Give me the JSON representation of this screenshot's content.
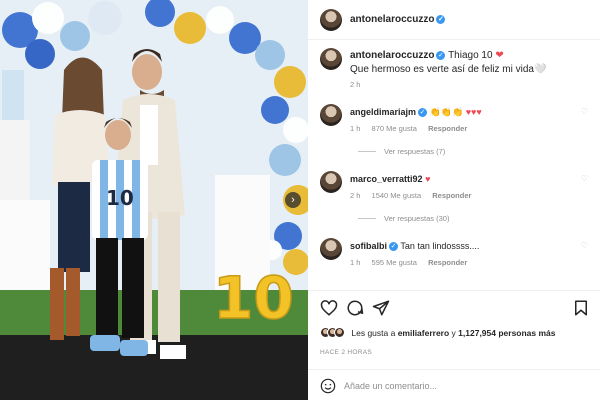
{
  "post": {
    "author": "antonelaroccuzzo",
    "caption_title": "Thiago 10",
    "caption_heart": "❤",
    "caption_body": "Que hermoso es verte así de feliz mi vida🤍",
    "caption_time": "2 h",
    "photo_big_number": "10",
    "photo_jersey_number": "10"
  },
  "comments": [
    {
      "username": "angeldimariajm",
      "text": "",
      "emojis_yellow": "👏👏👏",
      "emojis_red": "♥♥♥",
      "age": "1 h",
      "likes": "870 Me gusta",
      "reply": "Responder",
      "view_replies": "Ver respuestas (7)"
    },
    {
      "username": "marco_verratti92",
      "emojis_red": "♥",
      "age": "2 h",
      "likes": "1540 Me gusta",
      "reply": "Responder",
      "view_replies": "Ver respuestas (30)"
    },
    {
      "username": "sofibalbi",
      "text": "Tan tan lindossss....",
      "age": "1 h",
      "likes": "595 Me gusta",
      "reply": "Responder"
    }
  ],
  "engagement": {
    "likes_prefix": "Les gusta a ",
    "likes_user": "emiliaferrero",
    "likes_mid": " y ",
    "likes_count": "1,127,954 personas más",
    "timestamp": "HACE 2 HORAS"
  },
  "composer": {
    "placeholder": "Añade un comentario..."
  },
  "icons": {
    "like": "heart-outline-icon",
    "comment": "speech-bubble-icon",
    "share": "paper-plane-icon",
    "save": "bookmark-icon",
    "emoji": "smiley-icon",
    "verified": "verified-badge-icon",
    "next": "chevron-right-icon"
  },
  "colors": {
    "verified": "#3897f0",
    "heart": "#ed4956",
    "muted": "#8e8e8e",
    "text": "#262626"
  }
}
